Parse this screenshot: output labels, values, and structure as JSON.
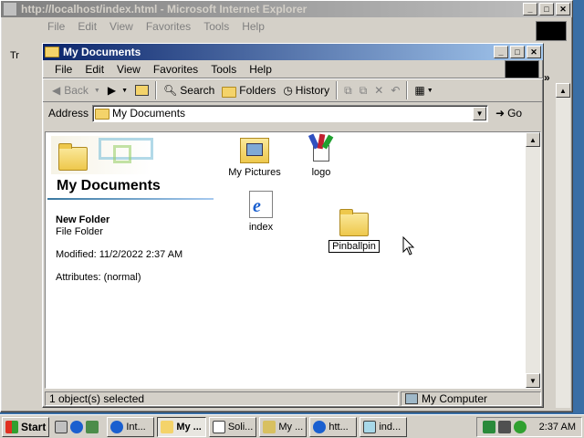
{
  "ie_window": {
    "title": "http://localhost/index.html - Microsoft Internet Explorer",
    "menu": [
      "File",
      "Edit",
      "View",
      "Favorites",
      "Tools",
      "Help"
    ],
    "left_fragment": "Tr",
    "right_fragment": "»"
  },
  "explorer": {
    "title": "My Documents",
    "menu": [
      "File",
      "Edit",
      "View",
      "Favorites",
      "Tools",
      "Help"
    ],
    "toolbar": {
      "back": "Back",
      "search": "Search",
      "folders": "Folders",
      "history": "History"
    },
    "address": {
      "label": "Address",
      "value": "My Documents",
      "go": "Go"
    },
    "webview": {
      "heading": "My Documents",
      "selected_name": "New Folder",
      "selected_type": "File Folder",
      "modified": "Modified: 11/2/2022 2:37 AM",
      "attributes": "Attributes: (normal)"
    },
    "items": [
      {
        "label": "My Pictures"
      },
      {
        "label": "logo"
      },
      {
        "label": "index"
      },
      {
        "label": "Pinballpin"
      }
    ],
    "status": {
      "selected": "1 object(s) selected",
      "zone": "My Computer"
    }
  },
  "taskbar": {
    "start": "Start",
    "buttons": [
      "Int...",
      "My ...",
      "Soli...",
      "My ...",
      "htt...",
      "ind..."
    ],
    "clock": "2:37 AM"
  },
  "colors": {
    "active_title_start": "#0a246a",
    "active_title_end": "#a6caf0",
    "desktop": "#3a6ea5"
  }
}
